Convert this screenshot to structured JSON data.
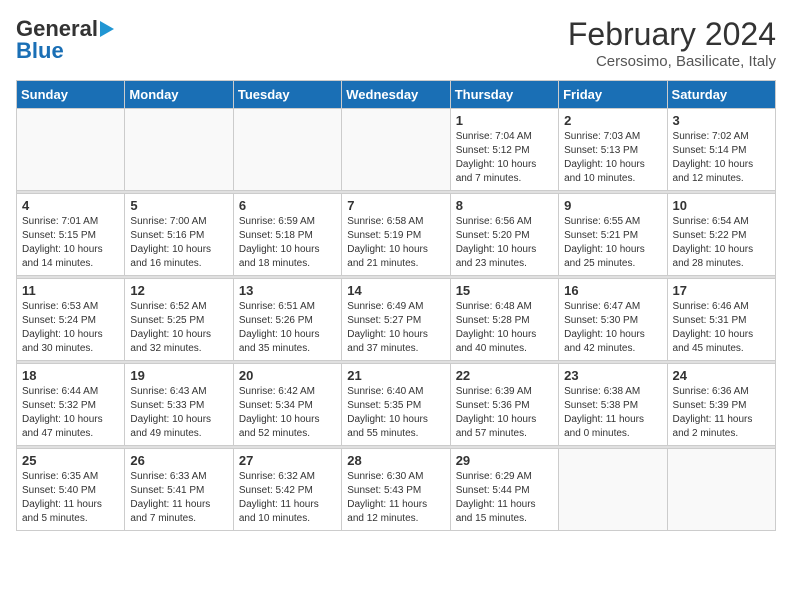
{
  "header": {
    "logo_general": "General",
    "logo_blue": "Blue",
    "month": "February 2024",
    "location": "Cersosimo, Basilicate, Italy"
  },
  "weekdays": [
    "Sunday",
    "Monday",
    "Tuesday",
    "Wednesday",
    "Thursday",
    "Friday",
    "Saturday"
  ],
  "weeks": [
    [
      {
        "day": "",
        "info": ""
      },
      {
        "day": "",
        "info": ""
      },
      {
        "day": "",
        "info": ""
      },
      {
        "day": "",
        "info": ""
      },
      {
        "day": "1",
        "info": "Sunrise: 7:04 AM\nSunset: 5:12 PM\nDaylight: 10 hours\nand 7 minutes."
      },
      {
        "day": "2",
        "info": "Sunrise: 7:03 AM\nSunset: 5:13 PM\nDaylight: 10 hours\nand 10 minutes."
      },
      {
        "day": "3",
        "info": "Sunrise: 7:02 AM\nSunset: 5:14 PM\nDaylight: 10 hours\nand 12 minutes."
      }
    ],
    [
      {
        "day": "4",
        "info": "Sunrise: 7:01 AM\nSunset: 5:15 PM\nDaylight: 10 hours\nand 14 minutes."
      },
      {
        "day": "5",
        "info": "Sunrise: 7:00 AM\nSunset: 5:16 PM\nDaylight: 10 hours\nand 16 minutes."
      },
      {
        "day": "6",
        "info": "Sunrise: 6:59 AM\nSunset: 5:18 PM\nDaylight: 10 hours\nand 18 minutes."
      },
      {
        "day": "7",
        "info": "Sunrise: 6:58 AM\nSunset: 5:19 PM\nDaylight: 10 hours\nand 21 minutes."
      },
      {
        "day": "8",
        "info": "Sunrise: 6:56 AM\nSunset: 5:20 PM\nDaylight: 10 hours\nand 23 minutes."
      },
      {
        "day": "9",
        "info": "Sunrise: 6:55 AM\nSunset: 5:21 PM\nDaylight: 10 hours\nand 25 minutes."
      },
      {
        "day": "10",
        "info": "Sunrise: 6:54 AM\nSunset: 5:22 PM\nDaylight: 10 hours\nand 28 minutes."
      }
    ],
    [
      {
        "day": "11",
        "info": "Sunrise: 6:53 AM\nSunset: 5:24 PM\nDaylight: 10 hours\nand 30 minutes."
      },
      {
        "day": "12",
        "info": "Sunrise: 6:52 AM\nSunset: 5:25 PM\nDaylight: 10 hours\nand 32 minutes."
      },
      {
        "day": "13",
        "info": "Sunrise: 6:51 AM\nSunset: 5:26 PM\nDaylight: 10 hours\nand 35 minutes."
      },
      {
        "day": "14",
        "info": "Sunrise: 6:49 AM\nSunset: 5:27 PM\nDaylight: 10 hours\nand 37 minutes."
      },
      {
        "day": "15",
        "info": "Sunrise: 6:48 AM\nSunset: 5:28 PM\nDaylight: 10 hours\nand 40 minutes."
      },
      {
        "day": "16",
        "info": "Sunrise: 6:47 AM\nSunset: 5:30 PM\nDaylight: 10 hours\nand 42 minutes."
      },
      {
        "day": "17",
        "info": "Sunrise: 6:46 AM\nSunset: 5:31 PM\nDaylight: 10 hours\nand 45 minutes."
      }
    ],
    [
      {
        "day": "18",
        "info": "Sunrise: 6:44 AM\nSunset: 5:32 PM\nDaylight: 10 hours\nand 47 minutes."
      },
      {
        "day": "19",
        "info": "Sunrise: 6:43 AM\nSunset: 5:33 PM\nDaylight: 10 hours\nand 49 minutes."
      },
      {
        "day": "20",
        "info": "Sunrise: 6:42 AM\nSunset: 5:34 PM\nDaylight: 10 hours\nand 52 minutes."
      },
      {
        "day": "21",
        "info": "Sunrise: 6:40 AM\nSunset: 5:35 PM\nDaylight: 10 hours\nand 55 minutes."
      },
      {
        "day": "22",
        "info": "Sunrise: 6:39 AM\nSunset: 5:36 PM\nDaylight: 10 hours\nand 57 minutes."
      },
      {
        "day": "23",
        "info": "Sunrise: 6:38 AM\nSunset: 5:38 PM\nDaylight: 11 hours\nand 0 minutes."
      },
      {
        "day": "24",
        "info": "Sunrise: 6:36 AM\nSunset: 5:39 PM\nDaylight: 11 hours\nand 2 minutes."
      }
    ],
    [
      {
        "day": "25",
        "info": "Sunrise: 6:35 AM\nSunset: 5:40 PM\nDaylight: 11 hours\nand 5 minutes."
      },
      {
        "day": "26",
        "info": "Sunrise: 6:33 AM\nSunset: 5:41 PM\nDaylight: 11 hours\nand 7 minutes."
      },
      {
        "day": "27",
        "info": "Sunrise: 6:32 AM\nSunset: 5:42 PM\nDaylight: 11 hours\nand 10 minutes."
      },
      {
        "day": "28",
        "info": "Sunrise: 6:30 AM\nSunset: 5:43 PM\nDaylight: 11 hours\nand 12 minutes."
      },
      {
        "day": "29",
        "info": "Sunrise: 6:29 AM\nSunset: 5:44 PM\nDaylight: 11 hours\nand 15 minutes."
      },
      {
        "day": "",
        "info": ""
      },
      {
        "day": "",
        "info": ""
      }
    ]
  ]
}
